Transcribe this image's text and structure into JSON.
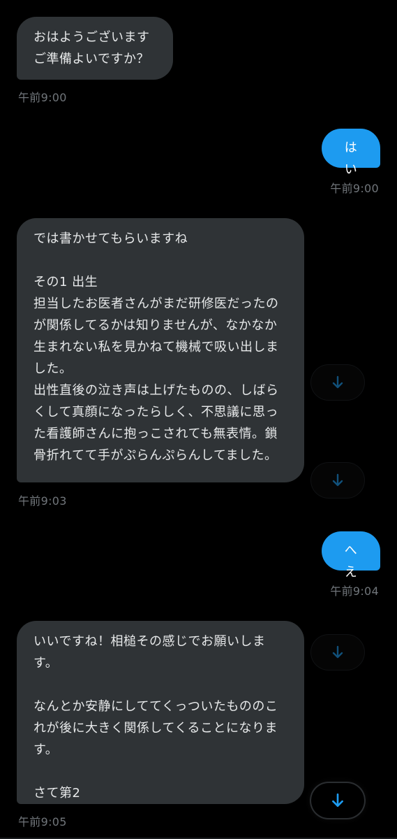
{
  "colors": {
    "background": "#000000",
    "incoming_bubble": "#2f3336",
    "outgoing_bubble": "#1d9bf0",
    "timestamp": "#71767b",
    "arrow_icon": "#1d9bf0"
  },
  "messages": [
    {
      "side": "incoming",
      "text": "おはようございます\nご準備よいですか？",
      "time": "午前9:00"
    },
    {
      "side": "outgoing",
      "text": "はい",
      "time": "午前9:00"
    },
    {
      "side": "incoming",
      "text": "では書かせてもらいますね\n\nその1 出生\n担当したお医者さんがまだ研修医だったのが関係してるかは知りませんが、なかなか生まれない私を見かねて機械で吸い出しました。\n出性直後の泣き声は上げたものの、しばらくして真顔になったらしく、不思議に思った看護師さんに抱っこされても無表情。鎖骨折れてて手がぷらんぷらんしてました。",
      "time": "午前9:03"
    },
    {
      "side": "outgoing",
      "text": "へえ",
      "time": "午前9:04"
    },
    {
      "side": "incoming",
      "text": "いいですね！相槌その感じでお願いします。\n\nなんとか安静にしててくっついたもののこれが後に大きく関係してくることになります。\n\nさて第2",
      "time": "午前9:05"
    }
  ],
  "icons": {
    "reaction_button": "arrow-down-icon"
  }
}
